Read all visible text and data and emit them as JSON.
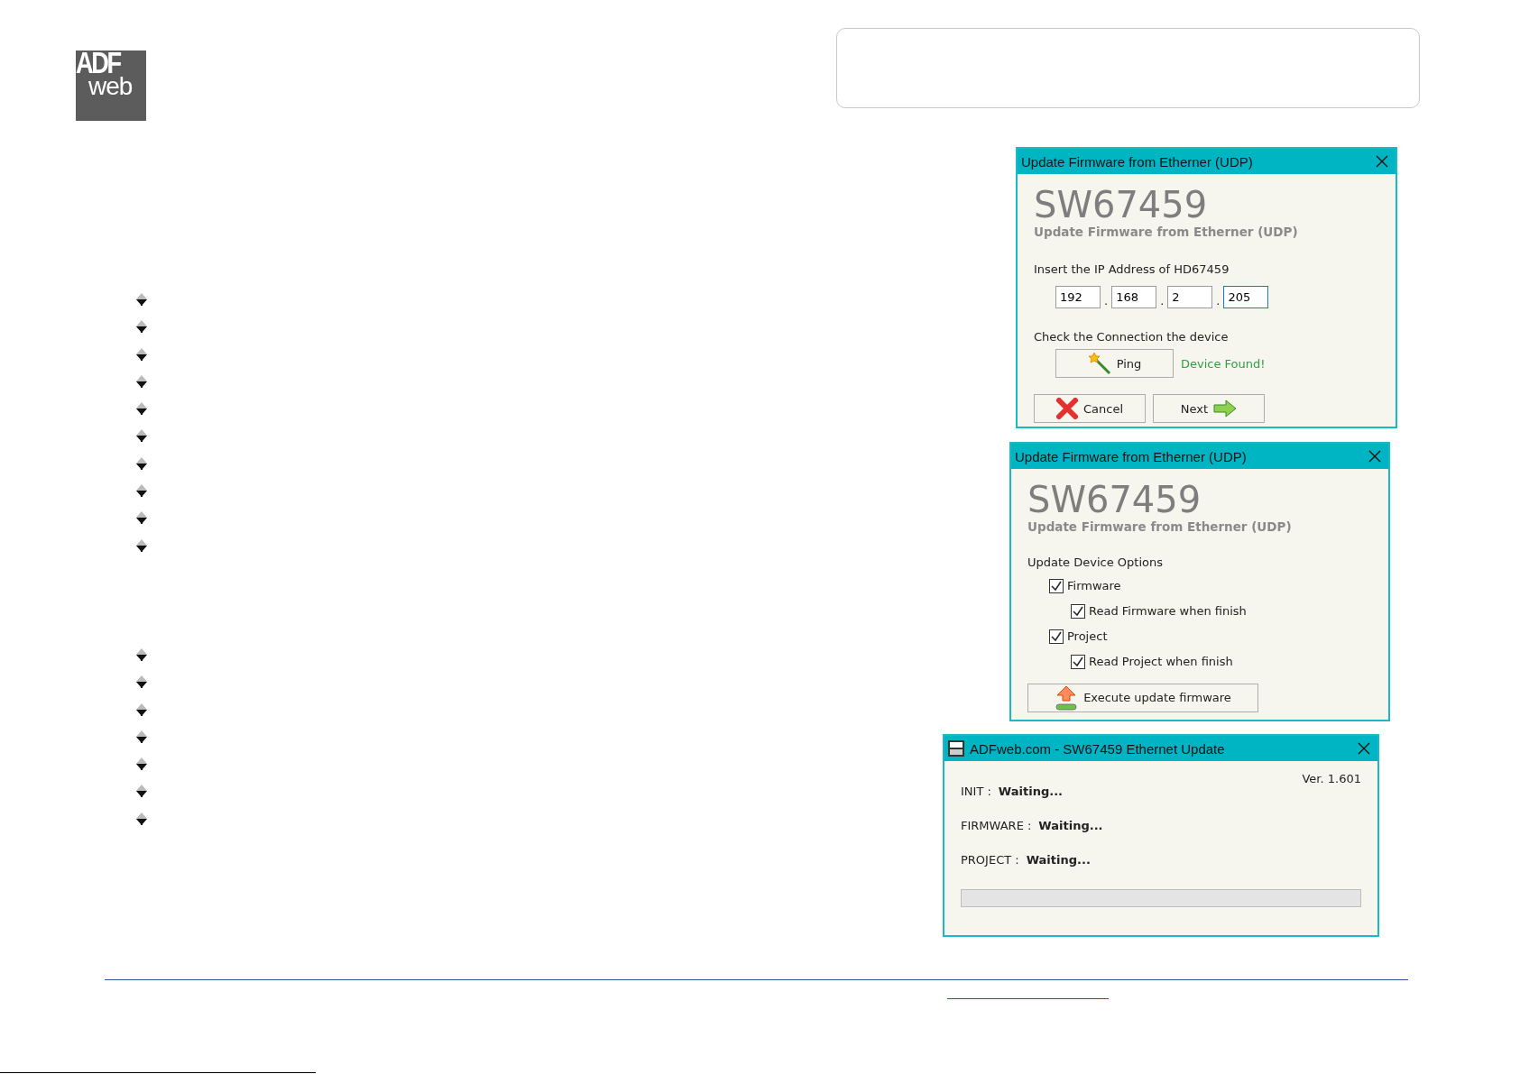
{
  "logo": {
    "top": "ADF",
    "bottom": "web"
  },
  "bullet_groups": [
    {
      "bullets": [
        {
          "kind": "bullet"
        },
        {
          "kind": "bullet"
        },
        {
          "kind": "bullet"
        },
        {
          "kind": "bullet"
        },
        {
          "kind": "bullet"
        },
        {
          "kind": "bullet"
        },
        {
          "kind": "bullet"
        },
        {
          "kind": "bullet"
        },
        {
          "kind": "bullet"
        },
        {
          "kind": "bullet"
        }
      ]
    },
    {
      "bullets": [
        {
          "kind": "bullet"
        },
        {
          "kind": "bullet"
        },
        {
          "kind": "bullet"
        },
        {
          "kind": "bullet"
        },
        {
          "kind": "bullet"
        },
        {
          "kind": "bullet"
        },
        {
          "kind": "bullet"
        }
      ]
    }
  ],
  "ip_dialog": {
    "title": "Update Firmware from Etherner (UDP)",
    "product": "SW67459",
    "subtitle": "Update Firmware from Etherner (UDP)",
    "ip_label": "Insert the IP Address of HD67459",
    "ip_octets": [
      {
        "value": "192",
        "focused": false
      },
      {
        "value": "168",
        "focused": false
      },
      {
        "value": "2",
        "focused": false
      },
      {
        "value": "205",
        "focused": true
      }
    ],
    "ip_separators": [
      ".",
      ".",
      "."
    ],
    "check_label": "Check the Connection the device",
    "ping_button": "Ping",
    "ping_status": "Device Found!",
    "buttons": [
      {
        "kind": "cancel",
        "label": "Cancel"
      },
      {
        "kind": "next",
        "label": "Next"
      }
    ]
  },
  "options_dialog": {
    "title": "Update Firmware from Etherner (UDP)",
    "product": "SW67459",
    "subtitle": "Update Firmware from Etherner (UDP)",
    "options_label": "Update Device Options",
    "options": [
      {
        "label": "Firmware",
        "checked": true,
        "children": [
          {
            "label": "Read Firmware when finish",
            "checked": true
          }
        ]
      },
      {
        "label": "Project",
        "checked": true,
        "children": [
          {
            "label": "Read Project when finish",
            "checked": true
          }
        ]
      }
    ],
    "execute_button": "Execute update firmware"
  },
  "progress_dialog": {
    "title": "ADFweb.com - SW67459 Ethernet Update",
    "version": "Ver. 1.601",
    "statuses": [
      {
        "label": "INIT :",
        "value": "Waiting..."
      },
      {
        "label": "FIRMWARE :",
        "value": "Waiting..."
      },
      {
        "label": "PROJECT :",
        "value": "Waiting..."
      }
    ],
    "progress": {
      "level": 0
    }
  }
}
